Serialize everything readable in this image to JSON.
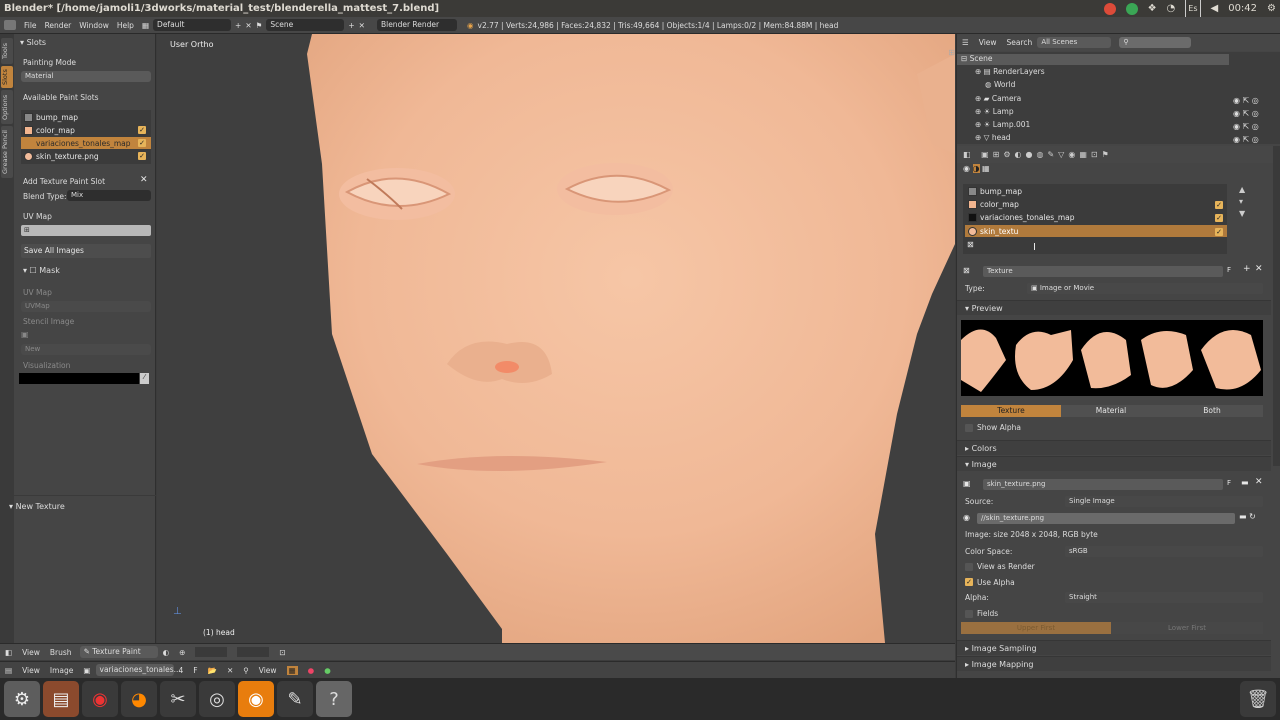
{
  "window": {
    "title": "Blender* [/home/jamoli1/3dworks/material_test/blenderella_mattest_7.blend]"
  },
  "system": {
    "keyboard": "Es",
    "time": "00:42"
  },
  "infobar": {
    "menus": [
      "File",
      "Render",
      "Window",
      "Help"
    ],
    "layout": "Default",
    "scene": "Scene",
    "engine": "Blender Render",
    "stats": "v2.77 | Verts:24,986 | Faces:24,832 | Tris:49,664 | Objects:1/4 | Lamps:0/2 | Mem:84.88M | head"
  },
  "toolshelf": {
    "tabs": [
      "Tools",
      "Slots",
      "Options",
      "Grease Pencil"
    ],
    "panel_title": "Slots",
    "painting_mode_label": "Painting Mode",
    "painting_mode_value": "Material",
    "available_slots_label": "Available Paint Slots",
    "slots": [
      "bump_map",
      "color_map",
      "variaciones_tonales_map",
      "skin_texture.png"
    ],
    "add_slot_label": "Add Texture Paint Slot",
    "blend_type_label": "Blend Type:",
    "blend_type_value": "Mix",
    "uv_map_label": "UV Map",
    "save_all_label": "Save All Images",
    "mask_title": "Mask",
    "mask_uvmap_label": "UV Map",
    "mask_uvmap_value": "UVMap",
    "stencil_label": "Stencil Image",
    "new_label": "New",
    "visualization_label": "Visualization",
    "new_texture_label": "New Texture"
  },
  "viewport": {
    "view_label": "User Ortho",
    "object_label": "(1) head"
  },
  "viewport_header": {
    "items": [
      "View",
      "Brush",
      "Texture Paint"
    ]
  },
  "image_header": {
    "items": [
      "View",
      "Image"
    ],
    "image_name": "variaciones_tonales...",
    "users": "4",
    "fake": "F",
    "view_label": "View"
  },
  "outliner": {
    "menus": [
      "View",
      "Search"
    ],
    "scenes": "All Scenes",
    "items": [
      "Scene",
      "RenderLayers",
      "World",
      "Camera",
      "Lamp",
      "Lamp.001",
      "head"
    ]
  },
  "properties": {
    "texture_slots": [
      "bump_map",
      "color_map",
      "variaciones_tonales_map",
      "skin_textu"
    ],
    "texture_name": "Texture",
    "texture_fake": "F",
    "type_label": "Type:",
    "type_value": "Image or Movie",
    "preview_label": "Preview",
    "preview_tabs": [
      "Texture",
      "Material",
      "Both"
    ],
    "show_alpha_label": "Show Alpha",
    "colors_label": "Colors",
    "image_label": "Image",
    "image_name": "skin_texture.png",
    "source_label": "Source:",
    "source_value": "Single Image",
    "filepath": "//skin_texture.png",
    "image_info": "Image: size 2048 x 2048, RGB byte",
    "color_space_label": "Color Space:",
    "color_space_value": "sRGB",
    "view_as_render_label": "View as Render",
    "use_alpha_label": "Use Alpha",
    "alpha_label": "Alpha:",
    "alpha_value": "Straight",
    "fields_label": "Fields",
    "upper_first_label": "Upper First",
    "lower_first_label": "Lower First",
    "image_sampling_label": "Image Sampling",
    "image_mapping_label": "Image Mapping"
  },
  "colors": {
    "accent": "#c1843d",
    "skin": "#f2bb9a",
    "panel": "#454545"
  }
}
